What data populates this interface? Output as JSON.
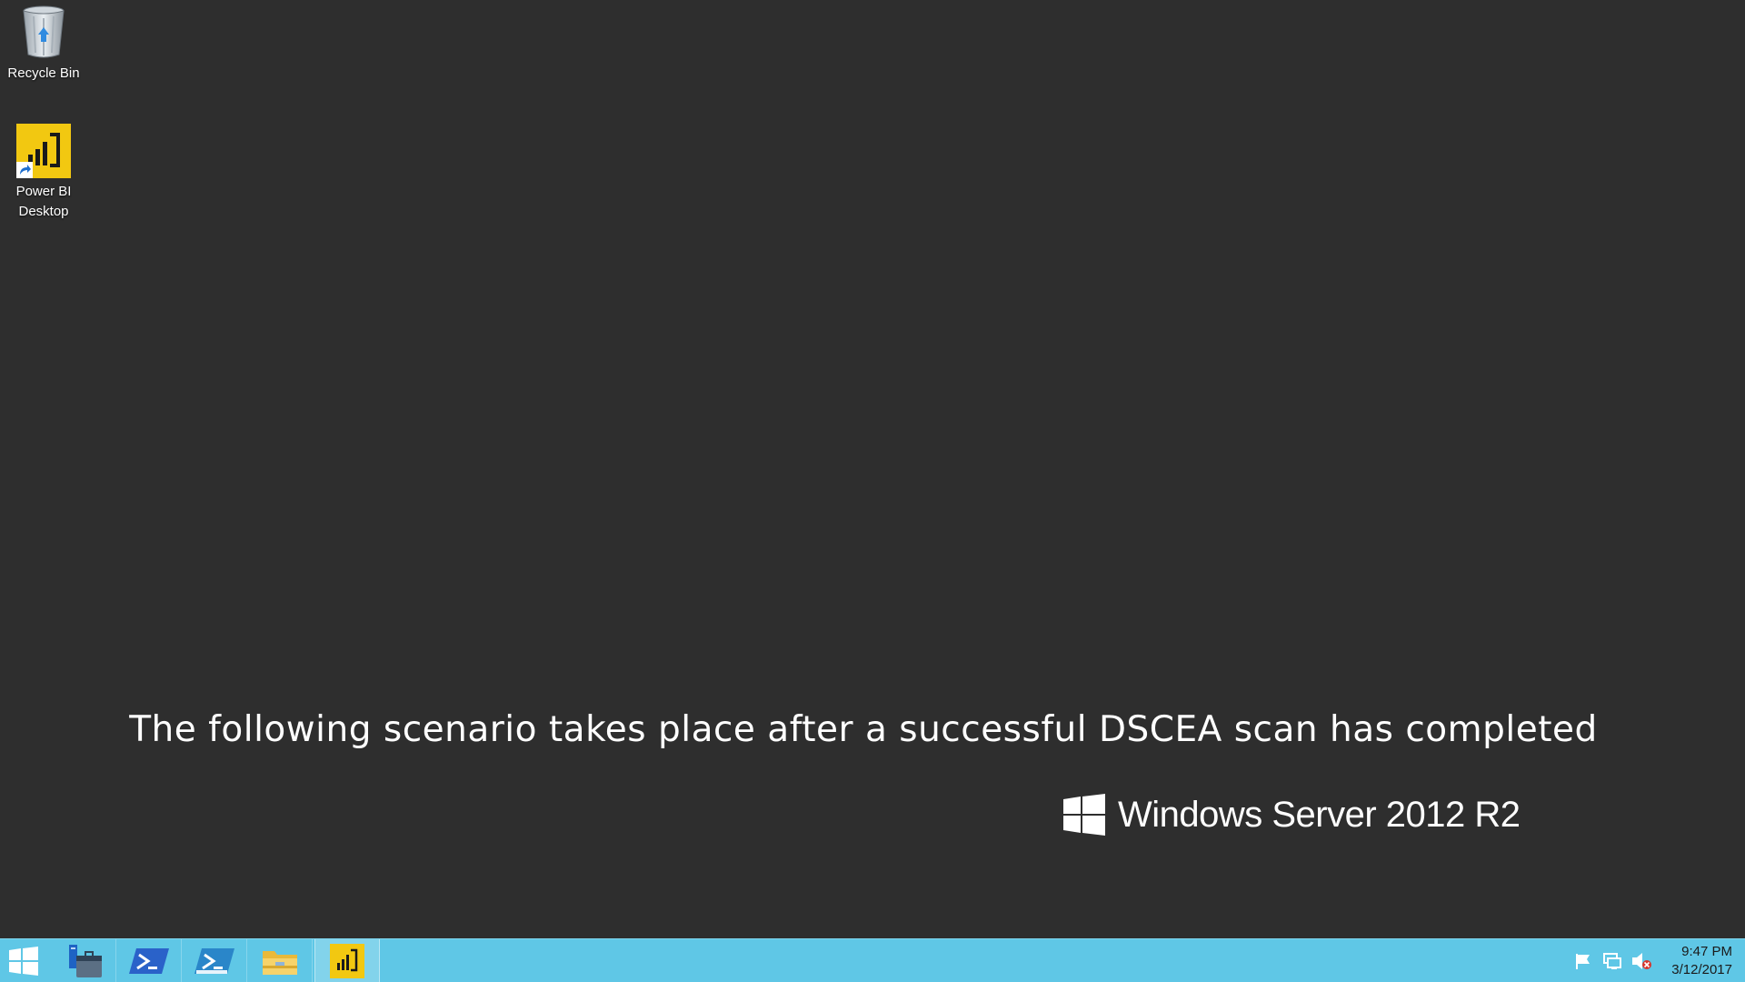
{
  "desktop": {
    "icons": [
      {
        "label": "Recycle Bin",
        "icon": "recycle-bin-icon"
      },
      {
        "label": "Power BI\nDesktop",
        "icon": "power-bi-icon"
      }
    ],
    "caption": "The following scenario takes place after a successful DSCEA scan has completed",
    "brand": "Windows Server 2012 R2"
  },
  "taskbar": {
    "buttons": [
      {
        "name": "start-button",
        "icon": "windows-logo-icon"
      },
      {
        "name": "server-manager-button",
        "icon": "server-manager-icon"
      },
      {
        "name": "powershell-button",
        "icon": "powershell-icon"
      },
      {
        "name": "powershell-ise-button",
        "icon": "powershell-ise-icon"
      },
      {
        "name": "file-explorer-button",
        "icon": "folder-icon"
      },
      {
        "name": "power-bi-button",
        "icon": "power-bi-icon",
        "active": true
      }
    ],
    "tray": {
      "icons": [
        "action-center-flag-icon",
        "network-icon",
        "volume-muted-icon"
      ],
      "time": "9:47 PM",
      "date": "3/12/2017"
    }
  },
  "colors": {
    "desktop_bg": "#2e2e2e",
    "taskbar_bg": "#5fc7e6",
    "power_bi_yellow": "#f2c811",
    "powershell_blue": "#2a62c9"
  }
}
